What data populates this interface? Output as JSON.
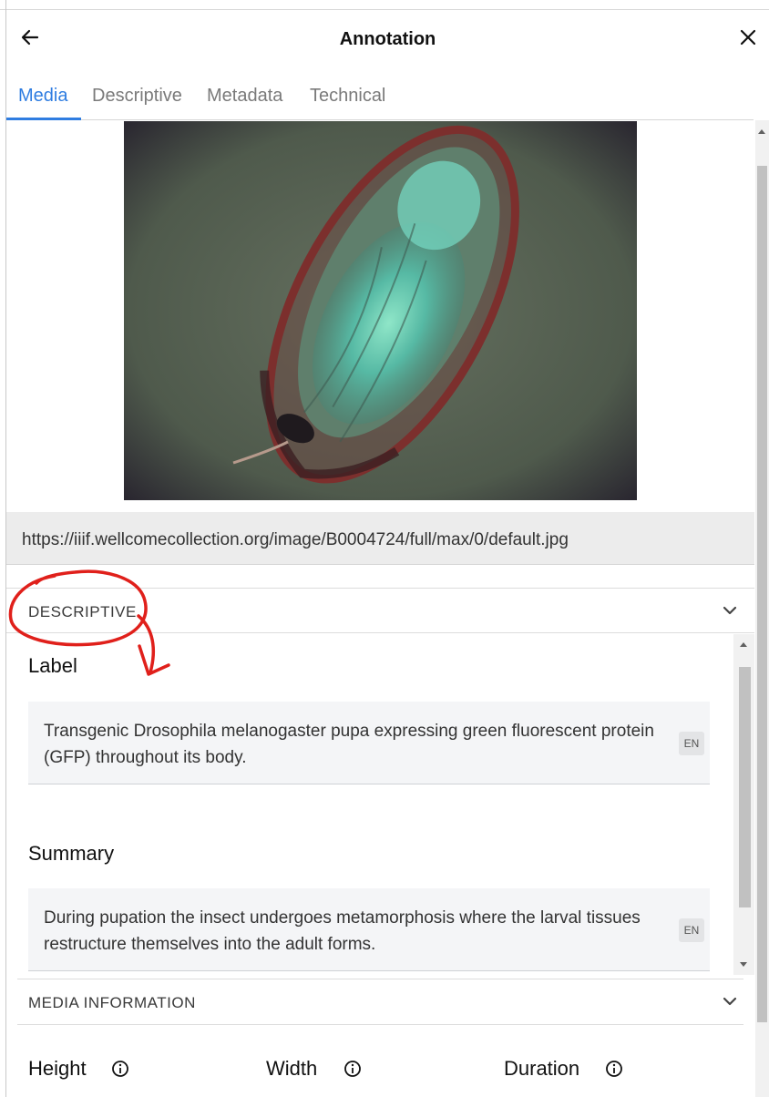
{
  "header": {
    "title": "Annotation",
    "back_icon": "arrow-left-icon",
    "close_icon": "close-icon"
  },
  "tabs": [
    {
      "label": "Media",
      "active": true
    },
    {
      "label": "Descriptive",
      "active": false
    },
    {
      "label": "Metadata",
      "active": false
    },
    {
      "label": "Technical",
      "active": false
    }
  ],
  "media": {
    "image_subject": "Transgenic Drosophila pupa (fluorescent micrograph)",
    "url": "https://iiif.wellcomecollection.org/image/B0004724/full/max/0/default.jpg"
  },
  "descriptive": {
    "section_label": "DESCRIPTIVE",
    "fields": [
      {
        "heading": "Label",
        "value": "Transgenic Drosophila melanogaster pupa expressing green fluorescent protein (GFP) throughout its body.",
        "lang": "EN"
      },
      {
        "heading": "Summary",
        "value": "During pupation the insect undergoes metamorphosis where the larval tissues restructure themselves into the adult forms.",
        "lang": "EN"
      }
    ]
  },
  "media_information": {
    "section_label": "MEDIA INFORMATION",
    "fields": [
      {
        "label": "Height"
      },
      {
        "label": "Width"
      },
      {
        "label": "Duration"
      }
    ]
  },
  "colors": {
    "accent": "#2f7de1",
    "annotation_red": "#e0201b"
  }
}
